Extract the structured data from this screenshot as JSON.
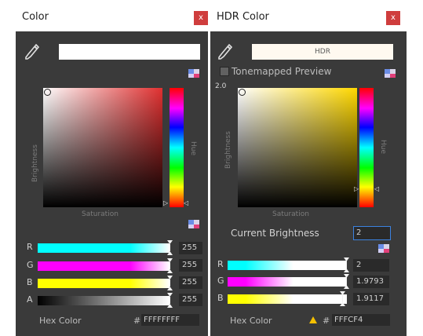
{
  "left_window": {
    "title": "Color",
    "close_label": "x",
    "swatch_color": "#FFFFFF",
    "saturation_label": "Saturation",
    "brightness_label": "Brightness",
    "hue_label": "Hue",
    "channels": [
      {
        "label": "R",
        "value": "255",
        "level": 1.0
      },
      {
        "label": "G",
        "value": "255",
        "level": 1.0
      },
      {
        "label": "B",
        "value": "255",
        "level": 1.0
      },
      {
        "label": "A",
        "value": "255",
        "level": 1.0
      }
    ],
    "hex_label": "Hex Color",
    "hex_hash": "#",
    "hex_value": "FFFFFFFF",
    "hue_gradient_color": "#e03030"
  },
  "right_window": {
    "title": "HDR Color",
    "close_label": "x",
    "swatch_label": "HDR",
    "swatch_color": "#FFF9F0",
    "tonemapped_label": "Tonemapped Preview",
    "max_brightness": "2.0",
    "saturation_label": "Saturation",
    "brightness_label": "Brightness",
    "hue_label": "Hue",
    "current_brightness_label": "Current Brightness",
    "current_brightness_value": "2",
    "channels": [
      {
        "label": "R",
        "value": "2",
        "level": 1.0
      },
      {
        "label": "G",
        "value": "1.9793",
        "level": 0.99
      },
      {
        "label": "B",
        "value": "1.9117",
        "level": 0.96
      }
    ],
    "hex_label": "Hex Color",
    "hex_hash": "#",
    "hex_value": "FFFCF4",
    "hue_gradient_color": "#ffd800"
  }
}
